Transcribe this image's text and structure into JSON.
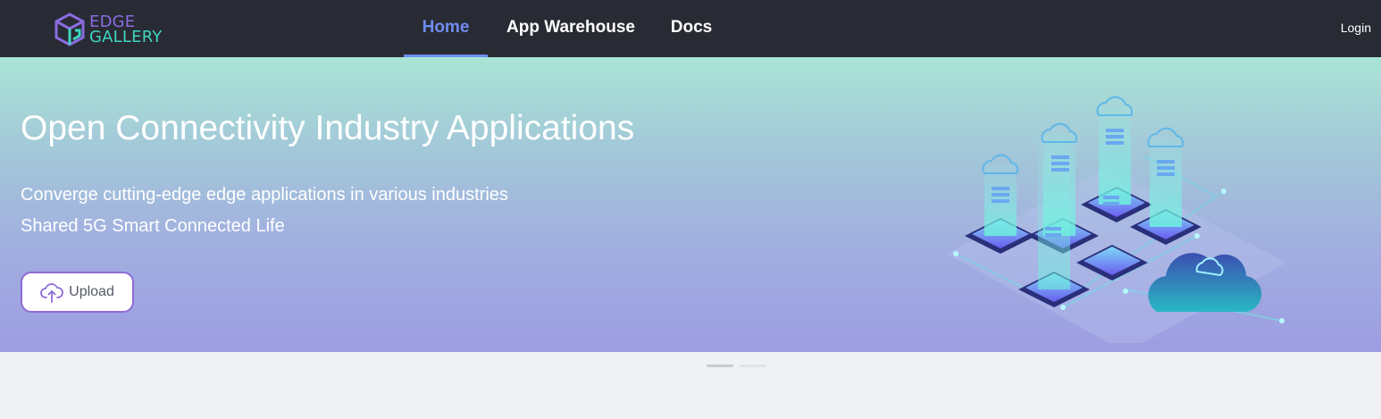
{
  "brand": {
    "line1": "EDGE",
    "line2": "GALLERY"
  },
  "nav": {
    "home": "Home",
    "app_warehouse": "App Warehouse",
    "docs": "Docs"
  },
  "header": {
    "login": "Login"
  },
  "banner": {
    "title": "Open Connectivity Industry Applications",
    "subtitle1": "Converge cutting-edge edge applications in various industries",
    "subtitle2": "Shared 5G Smart Connected Life",
    "upload_label": "Upload"
  },
  "carousel": {
    "active_index": 0,
    "slide_count": 2
  },
  "colors": {
    "header_bg": "#282b33",
    "accent": "#6f8cf0",
    "button_border": "#8d6cd6"
  }
}
